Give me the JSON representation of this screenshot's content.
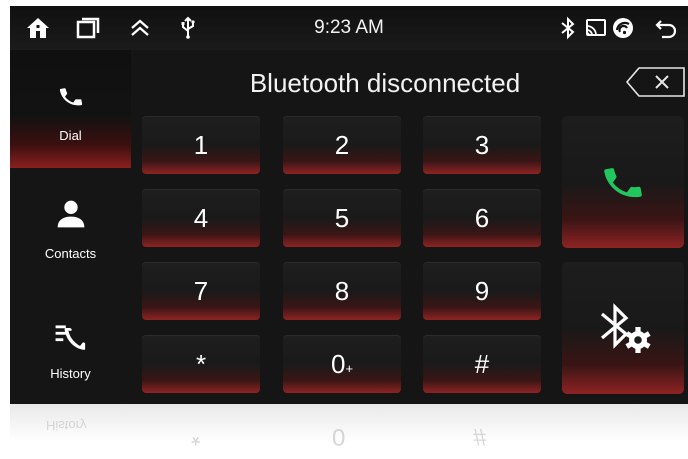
{
  "status_bar": {
    "time": "9:23 AM",
    "left_icons": [
      "home-icon",
      "recent-apps-icon",
      "chevron-up-icon",
      "usb-icon"
    ],
    "right_icons": [
      "bluetooth-icon",
      "screen-cast-icon",
      "wifi-icon",
      "back-icon"
    ]
  },
  "sidebar": {
    "items": [
      {
        "label": "Dial",
        "icon": "phone-icon",
        "active": true
      },
      {
        "label": "Contacts",
        "icon": "person-icon",
        "active": false
      },
      {
        "label": "History",
        "icon": "call-history-icon",
        "active": false
      }
    ]
  },
  "dialer": {
    "status_text": "Bluetooth disconnected",
    "keys": [
      "1",
      "2",
      "3",
      "4",
      "5",
      "6",
      "7",
      "8",
      "9",
      "*",
      "0",
      "#"
    ],
    "zero_sub": "+"
  },
  "actions": {
    "call_icon": "call-icon",
    "bt_settings_icon": "bluetooth-settings-icon"
  },
  "colors": {
    "background": "#151515",
    "accent_red": "#8f2323",
    "call_green": "#22c55e",
    "text": "#f2f2f2"
  }
}
